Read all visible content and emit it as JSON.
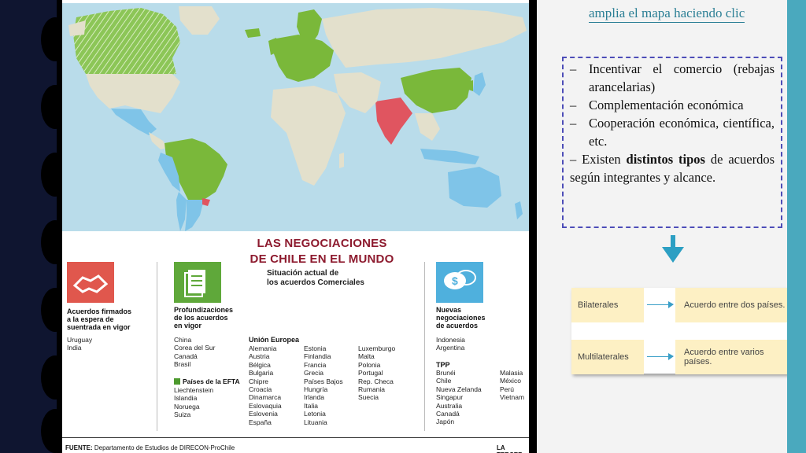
{
  "poster": {
    "title_line1": "LAS NEGOCIACIONES",
    "title_line2": "DE CHILE EN EL MUNDO",
    "subtitle_line1": "Situación actual de",
    "subtitle_line2": "los acuerdos Comerciales",
    "categories": [
      {
        "title_lines": [
          "Acuerdos firmados",
          "a la espera de",
          "suentrada en vigor"
        ],
        "items": [
          "Uruguay",
          "India"
        ],
        "icon": "handshake-icon",
        "color": "#e0574d"
      },
      {
        "title_lines": [
          "Profundizaciones",
          "de los acuerdos",
          "en vigor"
        ],
        "items": [
          "China",
          "Corea del Sur",
          "Canadá",
          "Brasil"
        ],
        "icon": "documents-icon",
        "color": "#5fa83a"
      },
      {
        "title_lines": [
          "Nuevas",
          "negociaciones",
          "de acuerdos"
        ],
        "items": [
          "Indonesia",
          "Argentina"
        ],
        "icon": "dollar-chat-icon",
        "color": "#4fb0dd"
      }
    ],
    "efta": {
      "label": "Países de la EFTA",
      "items": [
        "Liechtenstein",
        "Islandia",
        "Noruega",
        "Suiza"
      ]
    },
    "eu": {
      "title": "Unión Europea",
      "col1": [
        "Alemania",
        "Austria",
        "Bélgica",
        "Bulgaria",
        "Chipre",
        "Croacia",
        "Dinamarca",
        "Eslovaquia",
        "Eslovenia",
        "España"
      ],
      "col2": [
        "Estonia",
        "Finlandia",
        "Francia",
        "Grecia",
        "Países Bajos",
        "Hungría",
        "Irlanda",
        "Italia",
        "Letonia",
        "Lituania"
      ],
      "col3": [
        "Luxemburgo",
        "Malta",
        "Polonia",
        "Portugal",
        "Rep. Checa",
        "Rumania",
        "Suecia"
      ]
    },
    "tpp": {
      "title": "TPP",
      "col1": [
        "Brunéi",
        "Chile",
        "Nueva Zelanda",
        "Singapur",
        "Australia",
        "Canadá",
        "Japón"
      ],
      "col2": [
        "Malasia",
        "México",
        "Perú",
        "Vietnam"
      ]
    },
    "footer": {
      "source_label": "FUENTE:",
      "source_text": "Departamento de Estudios de DIRECON-ProChile",
      "brand": "LA TERCER"
    }
  },
  "right": {
    "link_text": "amplia el mapa haciendo clic",
    "bullets": [
      {
        "dash": "–",
        "text": "Incentivar el comercio (rebajas arancelarias)"
      },
      {
        "dash": "–",
        "text": "Complementación económica"
      },
      {
        "dash": "–",
        "text": "Cooperación económica, científica, etc."
      }
    ],
    "final_dash": "–",
    "final_pre": " Existen ",
    "final_bold": "distintos tipos",
    "final_post": " de acuerdos según integrantes y alcance.",
    "types": [
      {
        "label": "Bilaterales",
        "desc": "Acuerdo entre dos países."
      },
      {
        "label": "Multilaterales",
        "desc": "Acuerdo entre varios países."
      }
    ]
  },
  "colors": {
    "accent": "#2c9fc3",
    "box_border": "#4d4db8",
    "dark_band": "#0f1530",
    "poster_red": "#8d1a2e",
    "green": "#7ab83a",
    "blue": "#7fc4e8",
    "red": "#e05560",
    "land": "#e3e0cc",
    "strip": "#4aa9be"
  }
}
